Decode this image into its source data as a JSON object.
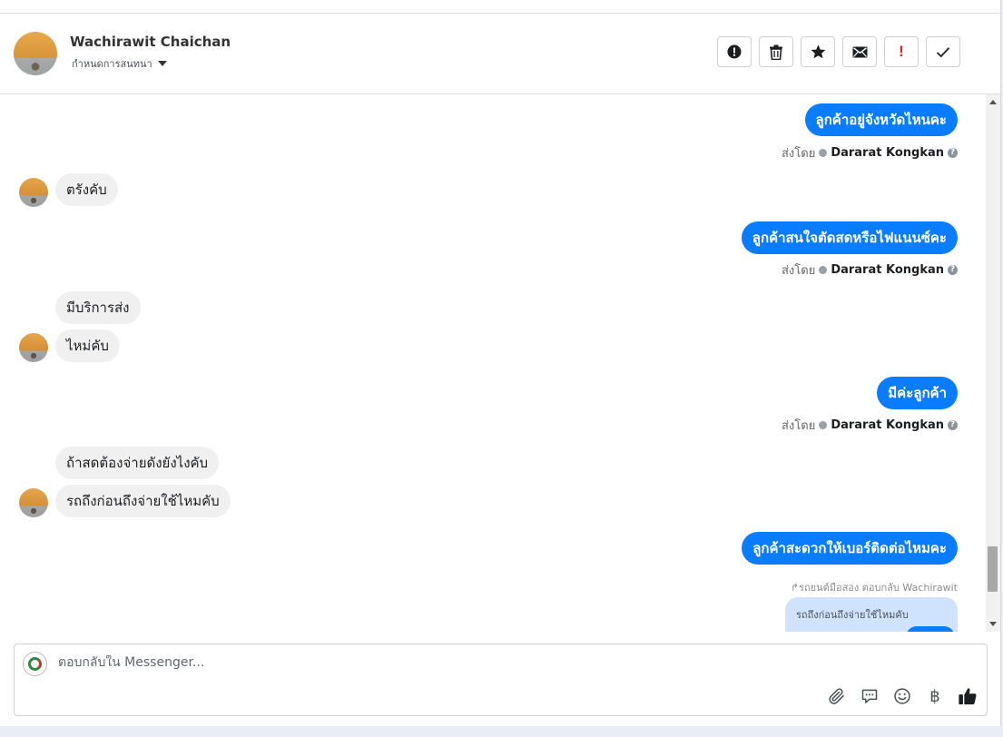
{
  "header": {
    "contact_name": "Wachirawit Chaichan",
    "conversation_settings": "กำหนดการสนทนา"
  },
  "toolbar": {
    "buttons": [
      {
        "name": "mark-spam",
        "icon": "alert-circle-icon"
      },
      {
        "name": "delete",
        "icon": "trash-icon"
      },
      {
        "name": "star",
        "icon": "star-icon"
      },
      {
        "name": "mark-unread",
        "icon": "envelope-icon"
      },
      {
        "name": "follow-up",
        "icon": "exclamation-icon",
        "glyph": "!"
      },
      {
        "name": "mark-done",
        "icon": "checkmark-icon"
      }
    ]
  },
  "thread": {
    "sent_by_label": "ส่งโดย",
    "agent_name": "Dararat Kongkan",
    "messages": [
      {
        "direction": "out",
        "text": "ลูกค้าอยู่จังหวัดไหนคะ"
      },
      {
        "direction": "in",
        "text": "ตรังคับ"
      },
      {
        "direction": "out",
        "text": "ลูกค้าสนใจตัดสดหรือไฟแนนซ์คะ"
      },
      {
        "direction": "in",
        "text": "มีบริการส่ง"
      },
      {
        "direction": "in",
        "text": "ไหม่คับ"
      },
      {
        "direction": "out",
        "text": "มีค่ะลูกค้า"
      },
      {
        "direction": "in",
        "text": "ถ้าสดต้องจ่ายดังยังไงคับ"
      },
      {
        "direction": "in",
        "text": "รถถึงก่อนถึงจ่ายใช้ไหมคับ"
      },
      {
        "direction": "out",
        "text": "ลูกค้าสะดวกให้เบอร์ติดต่อไหมคะ"
      }
    ],
    "reply_meta": "รถยนต์มือสอง ตอบกลับ Wachirawit",
    "quoted_text": "รถถึงก่อนถึงจ่ายใช้ไหมคับ"
  },
  "composer": {
    "placeholder": "ตอบกลับใน Messenger...",
    "value": "",
    "icons": [
      "paperclip-icon",
      "saved-replies-icon",
      "emoji-icon",
      "baht-icon",
      "thumbs-up-icon"
    ],
    "baht_glyph": "฿"
  },
  "colors": {
    "outgoing_bubble": "#0a7cff",
    "incoming_bubble": "#f0f0f0",
    "follow_up_red": "#e02020"
  }
}
